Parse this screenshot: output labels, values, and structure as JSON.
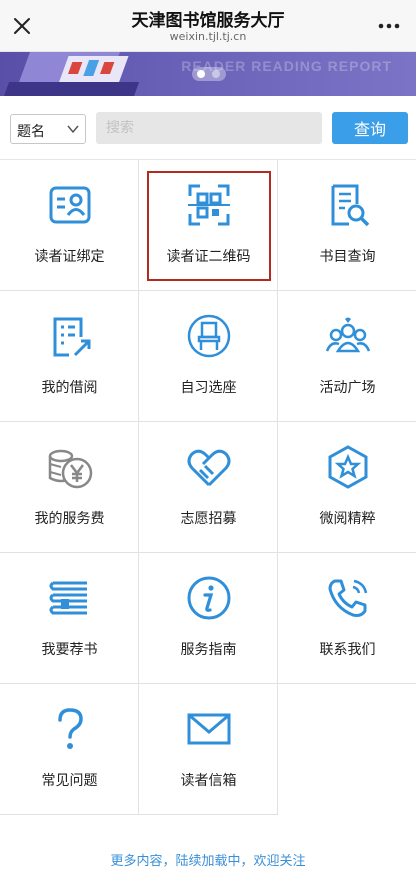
{
  "header": {
    "title": "天津图书馆服务大厅",
    "url": "weixin.tjl.tj.cn",
    "close_icon": "close-icon",
    "more_icon": "more-icon"
  },
  "banner": {
    "text": "READER READING REPORT",
    "slide_index": 1,
    "slide_count": 2
  },
  "search": {
    "select_value": "题名",
    "placeholder": "搜索",
    "button_label": "查询"
  },
  "grid": {
    "accent_color": "#2f8fd9",
    "items": [
      {
        "label": "读者证绑定",
        "icon": "id-card-icon"
      },
      {
        "label": "读者证二维码",
        "icon": "qr-code-icon"
      },
      {
        "label": "书目查询",
        "icon": "book-search-icon"
      },
      {
        "label": "我的借阅",
        "icon": "borrow-list-icon"
      },
      {
        "label": "自习选座",
        "icon": "chair-icon"
      },
      {
        "label": "活动广场",
        "icon": "people-icon"
      },
      {
        "label": "我的服务费",
        "icon": "coin-yen-icon"
      },
      {
        "label": "志愿招募",
        "icon": "handshake-heart-icon"
      },
      {
        "label": "微阅精粹",
        "icon": "star-hexagon-icon"
      },
      {
        "label": "我要荐书",
        "icon": "book-stack-icon"
      },
      {
        "label": "服务指南",
        "icon": "info-icon"
      },
      {
        "label": "联系我们",
        "icon": "phone-icon"
      },
      {
        "label": "常见问题",
        "icon": "question-icon"
      },
      {
        "label": "读者信箱",
        "icon": "mail-icon"
      }
    ]
  },
  "footer": {
    "text": "更多内容，陆续加载中，欢迎关注"
  }
}
